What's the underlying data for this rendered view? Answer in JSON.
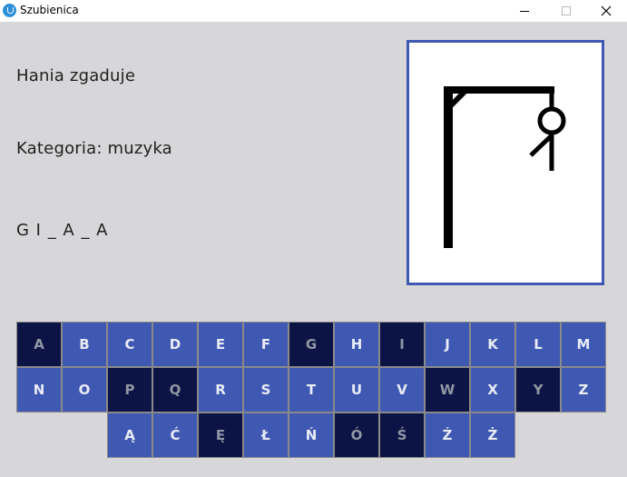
{
  "window": {
    "title": "Szubienica",
    "icon": "app-icon",
    "controls": [
      "minimize-icon",
      "maximize-icon",
      "close-icon"
    ]
  },
  "game": {
    "player_text": "Hania zgaduje",
    "category_text": "Kategoria: muzyka",
    "word_text": "G I _ A _ A",
    "wrong_guesses_drawn": 4
  },
  "colors": {
    "key_active": "#3f58b2",
    "key_used": "#0c1345",
    "background": "#d7d7d9",
    "frame_border": "#3f58b2"
  },
  "keyboard": {
    "rows": [
      [
        {
          "letter": "A",
          "used": true
        },
        {
          "letter": "B",
          "used": false
        },
        {
          "letter": "C",
          "used": false
        },
        {
          "letter": "D",
          "used": false
        },
        {
          "letter": "E",
          "used": false
        },
        {
          "letter": "F",
          "used": false
        },
        {
          "letter": "G",
          "used": true
        },
        {
          "letter": "H",
          "used": false
        },
        {
          "letter": "I",
          "used": true
        },
        {
          "letter": "J",
          "used": false
        },
        {
          "letter": "K",
          "used": false
        },
        {
          "letter": "L",
          "used": false
        },
        {
          "letter": "M",
          "used": false
        }
      ],
      [
        {
          "letter": "N",
          "used": false
        },
        {
          "letter": "O",
          "used": false
        },
        {
          "letter": "P",
          "used": true
        },
        {
          "letter": "Q",
          "used": true
        },
        {
          "letter": "R",
          "used": false
        },
        {
          "letter": "S",
          "used": false
        },
        {
          "letter": "T",
          "used": false
        },
        {
          "letter": "U",
          "used": false
        },
        {
          "letter": "V",
          "used": false
        },
        {
          "letter": "W",
          "used": true
        },
        {
          "letter": "X",
          "used": false
        },
        {
          "letter": "Y",
          "used": true
        },
        {
          "letter": "Z",
          "used": false
        }
      ],
      [
        {
          "letter": "Ą",
          "used": false
        },
        {
          "letter": "Ć",
          "used": false
        },
        {
          "letter": "Ę",
          "used": true
        },
        {
          "letter": "Ł",
          "used": false
        },
        {
          "letter": "Ń",
          "used": false
        },
        {
          "letter": "Ó",
          "used": true
        },
        {
          "letter": "Ś",
          "used": true
        },
        {
          "letter": "Ź",
          "used": false
        },
        {
          "letter": "Ż",
          "used": false
        }
      ]
    ]
  }
}
